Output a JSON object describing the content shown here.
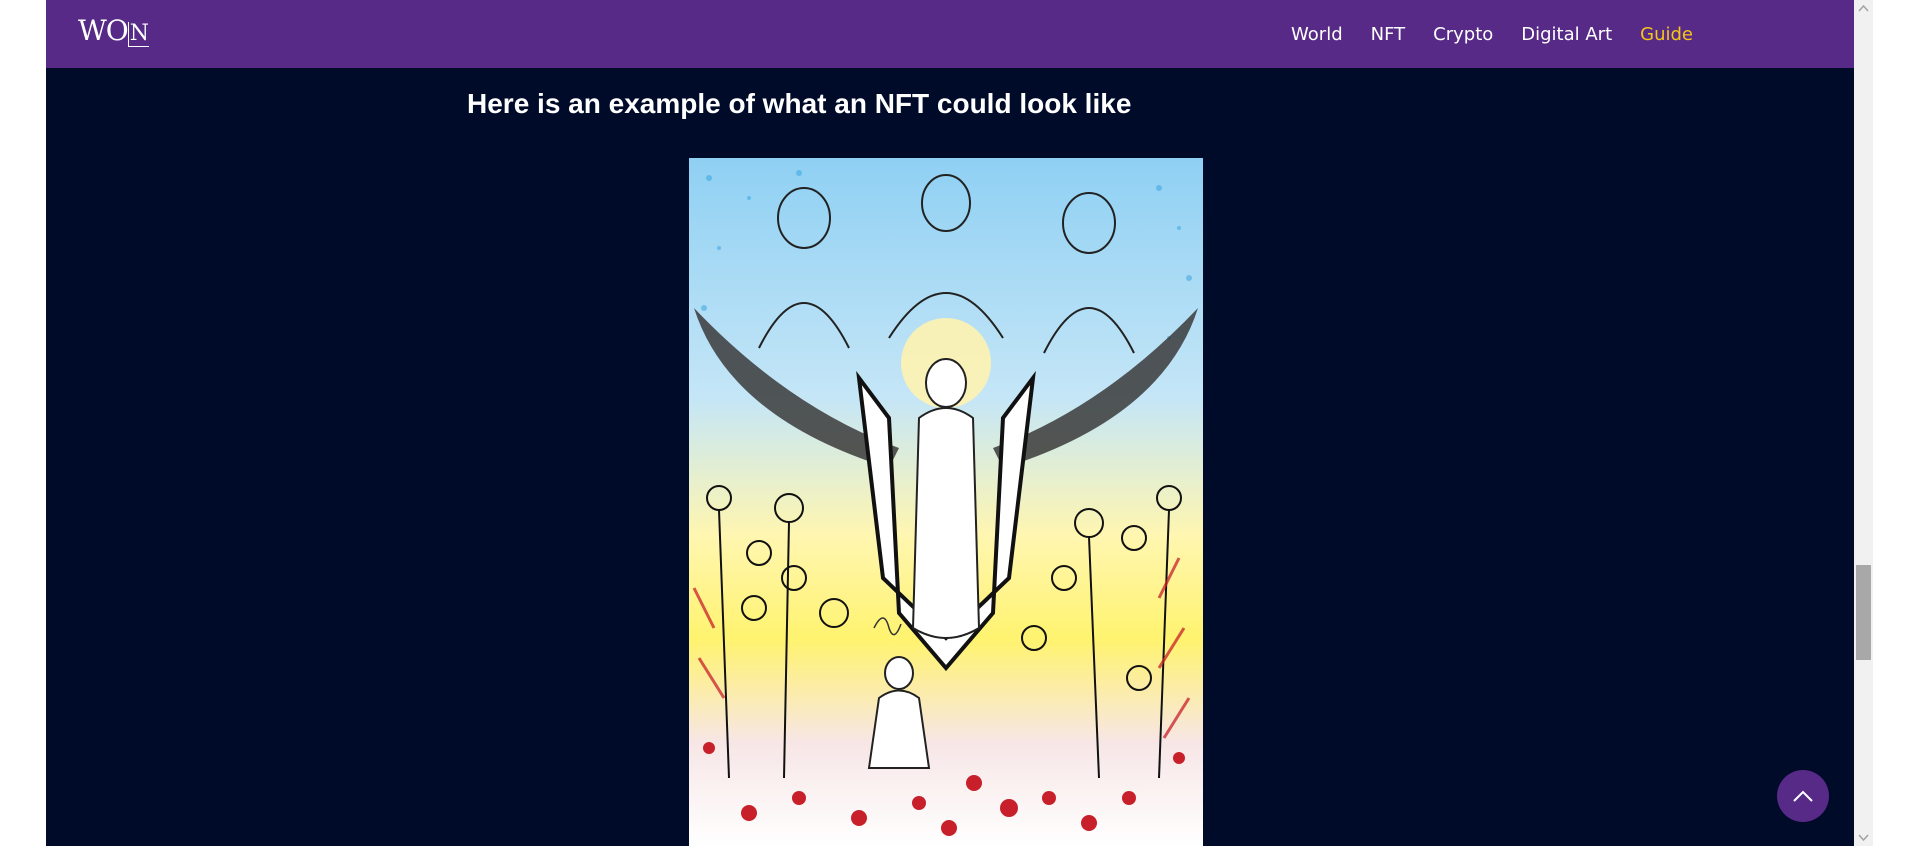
{
  "brand": {
    "logo_prefix": "W",
    "logo_middle": "O",
    "logo_suffix": "N"
  },
  "nav": {
    "items": [
      {
        "label": "World",
        "active": false
      },
      {
        "label": "NFT",
        "active": false
      },
      {
        "label": "Crypto",
        "active": false
      },
      {
        "label": "Digital Art",
        "active": false
      },
      {
        "label": "Guide",
        "active": true
      }
    ]
  },
  "main": {
    "headline": "Here is an example of what an NFT could look like"
  },
  "colors": {
    "nav_bg": "#572a87",
    "page_bg": "#000b29",
    "active_link": "#f5c518"
  },
  "icons": {
    "back_to_top": "chevron-up-icon",
    "scroll_up": "triangle-up-icon",
    "scroll_down": "triangle-down-icon"
  }
}
